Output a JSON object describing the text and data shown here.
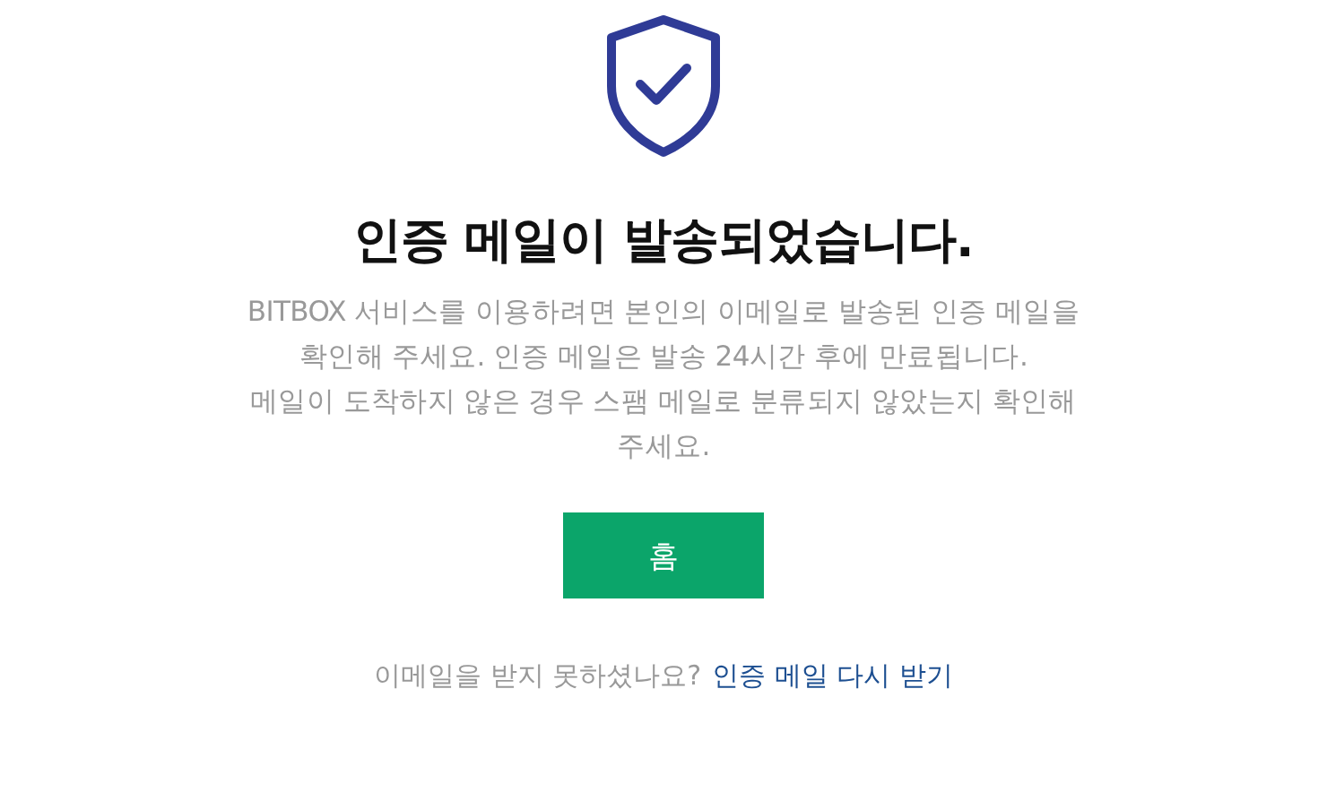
{
  "title": "인증 메일이 발송되었습니다.",
  "message_lines": [
    "BITBOX 서비스를 이용하려면 본인의 이메일로 발송된 인증 메일을",
    "확인해 주세요. 인증 메일은 발송 24시간 후에 만료됩니다.",
    "메일이 도착하지 않은 경우 스팸 메일로 분류되지 않았는지 확인해",
    "주세요."
  ],
  "button": {
    "label": "홈"
  },
  "resend": {
    "prompt": "이메일을 받지 못하셨나요?",
    "link": "인증 메일 다시 받기"
  }
}
